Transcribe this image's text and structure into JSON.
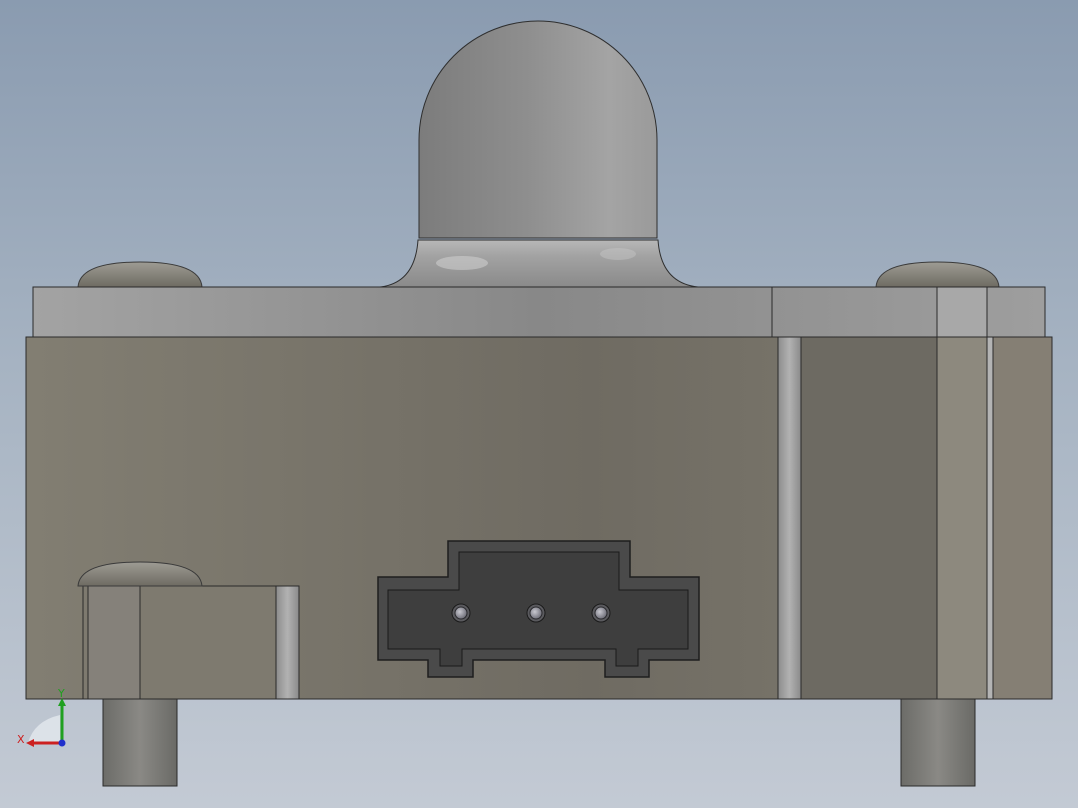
{
  "viewport": {
    "background_top": "#8a9bb0",
    "background_bottom": "#c3cad4"
  },
  "model": {
    "body_color": "#7a766b",
    "lid_color": "#9a9a9a",
    "connector_color": "#454545",
    "pin_count": 3
  },
  "triad": {
    "x_label": "X",
    "y_label": "Y",
    "x_color": "#cc2020",
    "y_color": "#20a020",
    "z_color": "#2030cc"
  }
}
